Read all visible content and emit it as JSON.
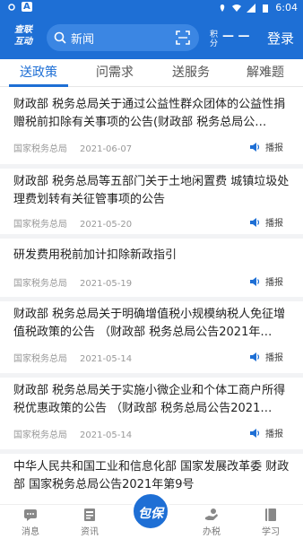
{
  "status": {
    "letter": "A",
    "time": "6:04"
  },
  "header": {
    "logo_line1": "查联",
    "logo_line2": "互动",
    "search_text": "新闻",
    "points_label": "积分",
    "points_value": "— —",
    "login": "登录"
  },
  "tabs": [
    {
      "label": "送政策",
      "active": true
    },
    {
      "label": "问需求",
      "active": false
    },
    {
      "label": "送服务",
      "active": false
    },
    {
      "label": "解难题",
      "active": false
    }
  ],
  "feed": [
    {
      "title": "财政部 税务总局关于通过公益性群众团体的公益性捐赠税前扣除有关事项的公告(财政部 税务总局公…",
      "source": "国家税务总局",
      "date": "2021-06-07",
      "play": "播报"
    },
    {
      "title": "财政部 税务总局等五部门关于土地闲置费 城镇垃圾处理费划转有关征管事项的公告",
      "source": "国家税务总局",
      "date": "2021-05-20",
      "play": "播报"
    },
    {
      "title": "研发费用税前加计扣除新政指引",
      "source": "国家税务总局",
      "date": "2021-05-19",
      "play": "播报"
    },
    {
      "title": "财政部 税务总局关于明确增值税小规模纳税人免征增值税政策的公告 （财政部 税务总局公告2021年…",
      "source": "国家税务总局",
      "date": "2021-05-14",
      "play": "播报"
    },
    {
      "title": "财政部 税务总局关于实施小微企业和个体工商户所得税优惠政策的公告 （财政部 税务总局公告2021…",
      "source": "国家税务总局",
      "date": "2021-05-14",
      "play": "播报"
    },
    {
      "title": "中华人民共和国工业和信息化部 国家发展改革委 财政部 国家税务总局公告2021年第9号",
      "source": "",
      "date": "",
      "play": ""
    }
  ],
  "bottom_nav": [
    {
      "label": "消息",
      "icon": "message-icon"
    },
    {
      "label": "资讯",
      "icon": "news-icon"
    },
    {
      "label": "办税",
      "icon": "hand-icon"
    },
    {
      "label": "学习",
      "icon": "book-icon"
    }
  ],
  "fab": {
    "label": "包保"
  },
  "colors": {
    "brand": "#1e6fd5",
    "search_bg": "#3b86e3",
    "divider": "#f2f3f5"
  }
}
